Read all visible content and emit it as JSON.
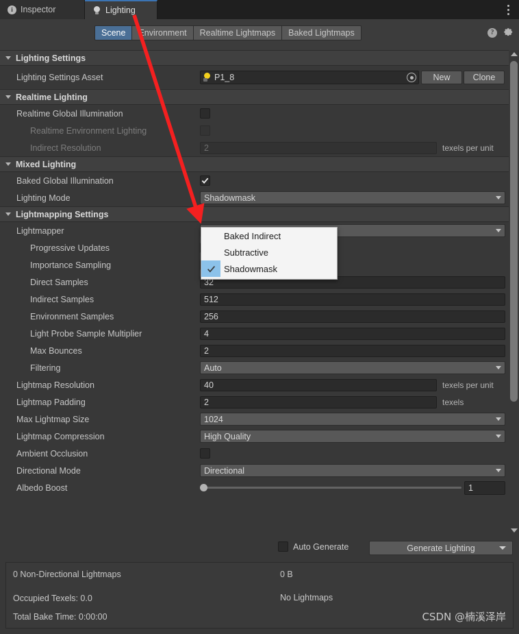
{
  "tabs": [
    {
      "label": "Inspector",
      "icon": "info-icon",
      "active": false
    },
    {
      "label": "Lighting",
      "icon": "lightbulb-icon",
      "active": true
    }
  ],
  "window_menu_icon": "kebab-menu-icon",
  "toolbar": {
    "modes": [
      {
        "label": "Scene",
        "selected": true
      },
      {
        "label": "Environment",
        "selected": false
      },
      {
        "label": "Realtime Lightmaps",
        "selected": false
      },
      {
        "label": "Baked Lightmaps",
        "selected": false
      }
    ],
    "help_icon": "help-icon",
    "gear_icon": "gear-icon"
  },
  "sections": {
    "lighting_settings": {
      "title": "Lighting Settings",
      "asset_row": {
        "label": "Lighting Settings Asset",
        "value": "P1_8",
        "asset_icon": "lightbulb-asset-icon",
        "picker_icon": "object-picker-icon",
        "new_label": "New",
        "clone_label": "Clone"
      }
    },
    "realtime_lighting": {
      "title": "Realtime Lighting",
      "rows": [
        {
          "label": "Realtime Global Illumination",
          "type": "checkbox",
          "checked": false,
          "dim": false
        },
        {
          "label": "Realtime Environment Lighting",
          "type": "checkbox",
          "checked": false,
          "dim": true
        },
        {
          "label": "Indirect Resolution",
          "type": "field",
          "value": "2",
          "unit": "texels per unit",
          "dim": true
        }
      ]
    },
    "mixed_lighting": {
      "title": "Mixed Lighting",
      "rows": [
        {
          "label": "Baked Global Illumination",
          "type": "checkbox",
          "checked": true
        },
        {
          "label": "Lighting Mode",
          "type": "popup",
          "value": "Shadowmask"
        }
      ]
    },
    "lightmapping_settings": {
      "title": "Lightmapping Settings",
      "rows": [
        {
          "label": "Lightmapper",
          "type": "popup",
          "value": ""
        },
        {
          "label": "Progressive Updates",
          "type": "checkbox",
          "checked": true
        },
        {
          "label": "Importance Sampling",
          "type": "checkbox",
          "checked": true
        },
        {
          "label": "Direct Samples",
          "type": "field",
          "value": "32"
        },
        {
          "label": "Indirect Samples",
          "type": "field",
          "value": "512"
        },
        {
          "label": "Environment Samples",
          "type": "field",
          "value": "256"
        },
        {
          "label": "Light Probe Sample Multiplier",
          "type": "field",
          "value": "4"
        },
        {
          "label": "Max Bounces",
          "type": "field",
          "value": "2"
        },
        {
          "label": "Filtering",
          "type": "popup",
          "value": "Auto"
        },
        {
          "label": "Lightmap Resolution",
          "type": "field",
          "value": "40",
          "unit": "texels per unit"
        },
        {
          "label": "Lightmap Padding",
          "type": "field",
          "value": "2",
          "unit": "texels"
        },
        {
          "label": "Max Lightmap Size",
          "type": "popup",
          "value": "1024"
        },
        {
          "label": "Lightmap Compression",
          "type": "popup",
          "value": "High Quality"
        },
        {
          "label": "Ambient Occlusion",
          "type": "checkbox",
          "checked": false
        },
        {
          "label": "Directional Mode",
          "type": "popup",
          "value": "Directional"
        },
        {
          "label": "Albedo Boost",
          "type": "slider",
          "value": "1",
          "slider_pos_pct": 0
        }
      ]
    }
  },
  "dropdown": {
    "open": true,
    "items": [
      {
        "label": "Baked Indirect",
        "checked": false
      },
      {
        "label": "Subtractive",
        "checked": false
      },
      {
        "label": "Shadowmask",
        "checked": true
      }
    ]
  },
  "footer": {
    "auto_generate_label": "Auto Generate",
    "auto_generate_checked": false,
    "generate_button_label": "Generate Lighting",
    "stats": {
      "lightmaps_count": "0 Non-Directional Lightmaps",
      "size": "0 B",
      "no_lightmaps": "No Lightmaps",
      "occupied_texels": "Occupied Texels: 0.0",
      "total_bake_time": "Total Bake Time: 0:00:00"
    },
    "watermark": "CSDN @楠溪泽岸"
  },
  "scrollbar": {
    "up_icon": "scroll-up-arrow-icon",
    "down_icon": "scroll-down-arrow-icon"
  },
  "annotation": {
    "color": "#f42020",
    "type": "arrow",
    "points_to": "lighting-mode-dropdown"
  },
  "colors": {
    "accent_blue": "#4a6f96",
    "panel_bg": "#383838",
    "header_bg": "#404040",
    "field_bg": "#2b2b2b",
    "popup_bg": "#585858",
    "annotation_red": "#f42020",
    "asset_icon_yellow": "#f2cf1d",
    "dropdown_highlight": "#8cc2ea"
  }
}
